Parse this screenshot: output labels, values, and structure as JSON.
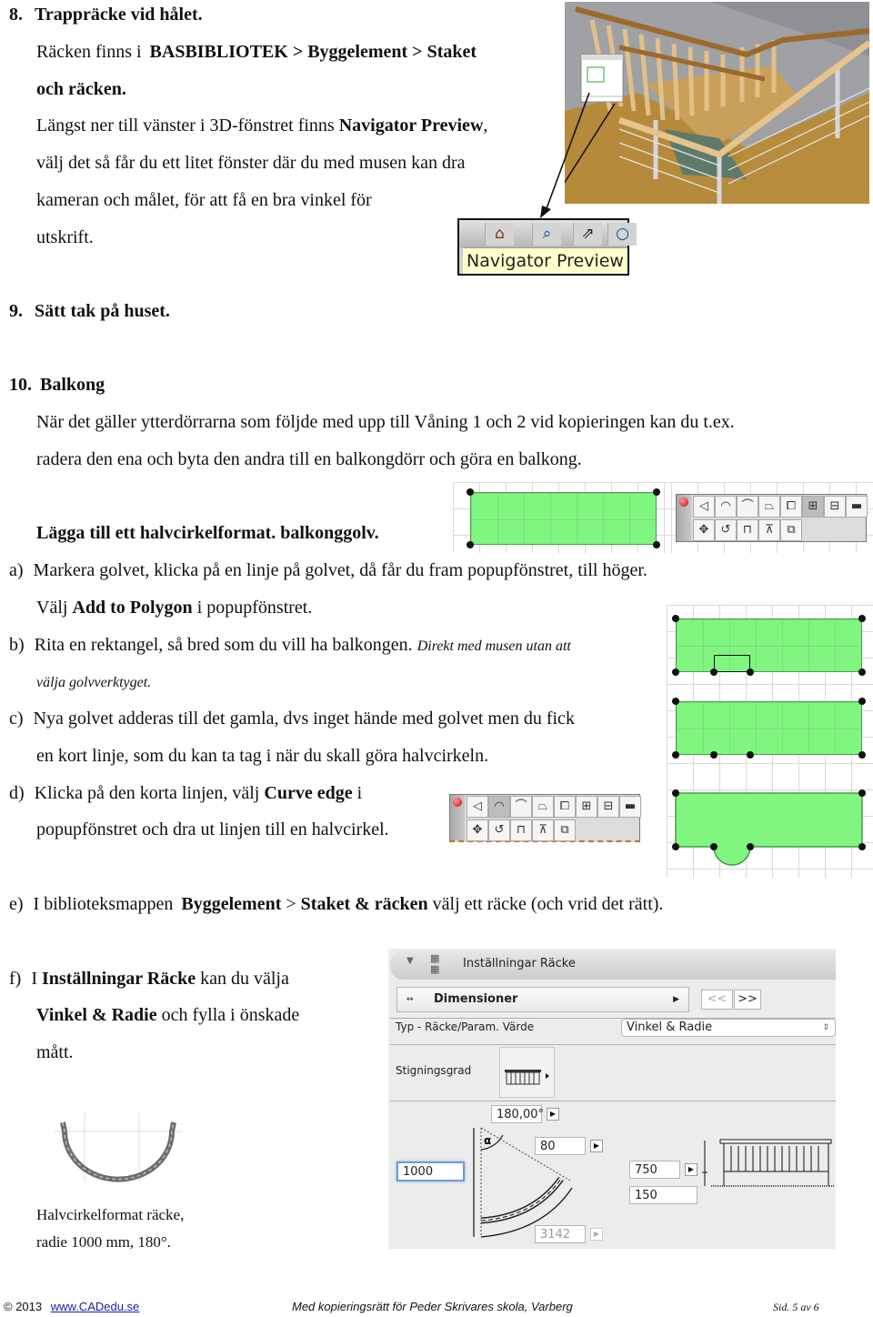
{
  "section8": {
    "number": "8.",
    "title": "Trappräcke vid hålet.",
    "line1_pre": "Räcken finns i",
    "line1_bold": "BASBIBLIOTEK > Byggelement > Staket",
    "line2_bold": "och räcken.",
    "line3_pre": "Längst ner till vänster i 3D-fönstret finns",
    "line3_bold": "Navigator Preview",
    "line3_post": ",",
    "line4": "välj det så får du ett litet fönster där du med musen kan dra",
    "line5": "kameran och målet, för att få en bra vinkel för",
    "line6": "utskrift.",
    "tooltip": "Navigator Preview",
    "toolbar_icons": [
      "navigator-house-icon",
      "zoom-in-icon",
      "pan-icon",
      "zoom-icon"
    ]
  },
  "section9": {
    "number": "9.",
    "title": "Sätt tak på huset."
  },
  "section10": {
    "number": "10.",
    "title": "Balkong",
    "para1": "När det gäller ytterdörrarna som följde med upp till Våning 1 och 2 vid kopieringen kan du t.ex.",
    "para2": "radera den ena och byta den andra till en balkongdörr och göra en balkong.",
    "subtitle": "Lägga till ett halvcirkelformat. balkonggolv.",
    "steps": {
      "a": {
        "label": "a)",
        "line1": "Markera golvet, klicka på en linje på golvet, då får du fram popupfönstret, till höger.",
        "line2_pre": "Välj",
        "line2_bold": "Add to Polygon",
        "line2_post": "i popupfönstret."
      },
      "b": {
        "label": "b)",
        "line1": "Rita en rektangel, så bred som du vill ha balkongen.",
        "line1_italic": "Direkt med musen utan att",
        "line2_italic": "välja golvverktyget."
      },
      "c": {
        "label": "c)",
        "line1": "Nya golvet adderas till det gamla, dvs inget hände med golvet men du fick",
        "line2": "en kort linje, som du kan ta tag i när du skall göra halvcirkeln."
      },
      "d": {
        "label": "d)",
        "line1_pre": "Klicka på den korta linjen,  välj",
        "line1_bold": "Curve edge",
        "line1_post": "i",
        "line2": "popupfönstret och dra ut linjen till en halvcirkel."
      },
      "e": {
        "label": "e)",
        "pre": "I biblioteksmappen",
        "bold1": "Byggelement",
        "sep": ">",
        "bold2": "Staket & räcken",
        "post": "välj ett räcke (och vrid det rätt)."
      },
      "f": {
        "label": "f)",
        "line1_pre": "I",
        "line1_bold": "Inställningar Räcke",
        "line1_post": "kan du välja",
        "line2_bold": "Vinkel & Radie",
        "line2_post": "och fylla i önskade",
        "line3": "mått."
      }
    },
    "popup_toolbar": {
      "row1": [
        "◁",
        "◠",
        "⌒",
        "⏢",
        "⧠",
        "⊞",
        "⊟",
        "▬"
      ],
      "row2": [
        "✥",
        "↺",
        "⊓",
        "⊼",
        "⧉"
      ],
      "active_index_add_polygon": 5,
      "active_index_curve_edge": 1
    }
  },
  "caption": {
    "line1": "Halvcirkelformat räcke,",
    "line2": "radie 1000 mm, 180°."
  },
  "settings_panel": {
    "title": "Inställningar Räcke",
    "page_select": "Dimensioner",
    "prev_label": "<<",
    "next_label": ">>",
    "type_label": "Typ - Räcke/Param. Värde",
    "type_value": "Vinkel & Radie",
    "slope_label": "Stigningsgrad",
    "angle_value": "180,00°",
    "angle_symbol": "α",
    "width_value": "80",
    "radius_value": "1000",
    "arc_length_value": "3142",
    "height_value": "750",
    "bottom_value": "150"
  },
  "footer": {
    "copyright": "© 2013",
    "link": "www.CADedu.se",
    "center": "Med kopieringsrätt för Peder Skrivares skola, Varberg",
    "page": "Sid. 5 av 6"
  }
}
